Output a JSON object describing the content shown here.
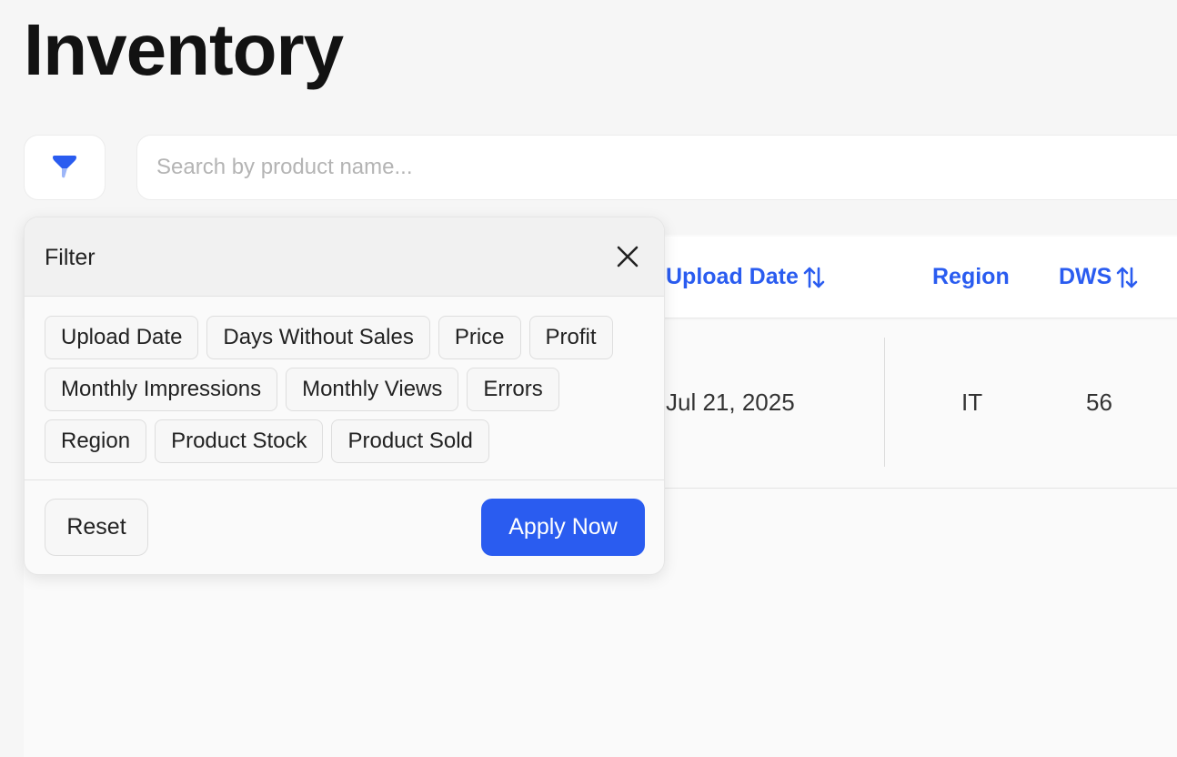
{
  "page": {
    "title": "Inventory"
  },
  "search": {
    "placeholder": "Search by product name...",
    "value": ""
  },
  "filter_toggle": {
    "icon": "funnel-icon"
  },
  "table": {
    "columns": [
      {
        "label": "Upload Date",
        "sortable": true
      },
      {
        "label": "Region",
        "sortable": false
      },
      {
        "label": "DWS",
        "sortable": true
      }
    ],
    "rows": [
      {
        "upload_date": "Jul 21, 2025",
        "region": "IT",
        "dws": "56"
      }
    ]
  },
  "filter_panel": {
    "title": "Filter",
    "options": [
      "Upload Date",
      "Days Without Sales",
      "Price",
      "Profit",
      "Monthly Impressions",
      "Monthly Views",
      "Errors",
      "Region",
      "Product Stock",
      "Product Sold"
    ],
    "reset_label": "Reset",
    "apply_label": "Apply Now"
  },
  "colors": {
    "accent": "#2a5cf0",
    "background": "#f6f6f6",
    "panel": "#fafafa"
  }
}
